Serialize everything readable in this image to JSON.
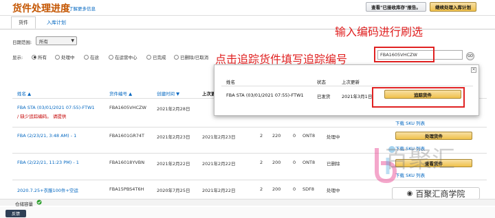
{
  "header": {
    "title": "货件处理进度",
    "learn_more": "了解更多信息",
    "btn_view_received": "查看\"已接收库存\"报告。",
    "btn_continue_plan": "继续处理入库计划"
  },
  "tabs": [
    {
      "label": "货件"
    },
    {
      "label": "入库计划"
    }
  ],
  "filters": {
    "date_range_label": "日期范围:",
    "date_range_value": "所有",
    "show_label": "显示:",
    "radios": [
      {
        "label": "所有",
        "checked": true
      },
      {
        "label": "处理中",
        "checked": false
      },
      {
        "label": "在途",
        "checked": false
      },
      {
        "label": "在运营中心",
        "checked": false
      },
      {
        "label": "已完成",
        "checked": false
      },
      {
        "label": "已删除/已取消",
        "checked": false
      }
    ],
    "search_value": "FBA1605VHCZW",
    "go_label": "GO"
  },
  "table": {
    "headers": [
      "姓名 ▲",
      "货件编号 ▲",
      "创建时间 ▼",
      "上次更"
    ],
    "rows": [
      {
        "name": "FBA STA (03/01/2021 07:55)-FTW1",
        "note": "/ 缺少追踪编码。 请提供",
        "id": "FBA1605VHCZW",
        "created": "2021年2月28日",
        "updated": "",
        "a": "",
        "b": "",
        "c": "",
        "dest": "",
        "status": "",
        "action": "",
        "sku": "下载 SKU 列表"
      },
      {
        "name": "FBA (2/23/21, 3:48 AM) - 1",
        "note": "",
        "id": "FBA1601GR74T",
        "created": "2021年2月23日",
        "updated": "2021年2月23日",
        "a": "2",
        "b": "220",
        "c": "0",
        "dest": "ONT8",
        "status": "处理中",
        "action": "处理货件",
        "sku": "下载 SKU 列表"
      },
      {
        "name": "FBA (2/22/21, 11:23 PM) - 1",
        "note": "",
        "id": "FBA16018YVBN",
        "created": "2021年2月22日",
        "updated": "2021年2月22日",
        "a": "2",
        "b": "200",
        "c": "0",
        "dest": "ONT8",
        "status": "已删除",
        "action": "查看货件",
        "sku": "下载 SKU 列表"
      },
      {
        "name": "2020.7.25+衣服100件+空运",
        "note": "",
        "id": "FBA15PBS4T6H",
        "created": "2020年7月25日",
        "updated": "2021年2月22日",
        "a": "2",
        "b": "200",
        "c": "0",
        "dest": "SDF8",
        "status": "处理中",
        "action": "",
        "sku": ""
      }
    ]
  },
  "popup": {
    "h_name": "姓名",
    "h_status": "状态",
    "h_updated": "上次更新",
    "name": "FBA STA (03/01/2021 07:55)-FTW1",
    "status": "已发货",
    "updated": "2021年3月1日",
    "track_btn": "追踪货件",
    "close": "✕"
  },
  "annotations": {
    "input_hint": "输入编码进行刷选",
    "click_hint": "点击追踪货件填写追踪编号"
  },
  "footer": {
    "warehouse": "仓储容量",
    "feedback": "反馈"
  },
  "watermark": {
    "logo_text": "百聚汇",
    "bar_text": "百聚汇商学院"
  },
  "colors": {
    "accent_orange": "#c45500",
    "button_yellow": "#f0c14b",
    "annotation_red": "#e02020",
    "link_blue": "#0066c0"
  }
}
